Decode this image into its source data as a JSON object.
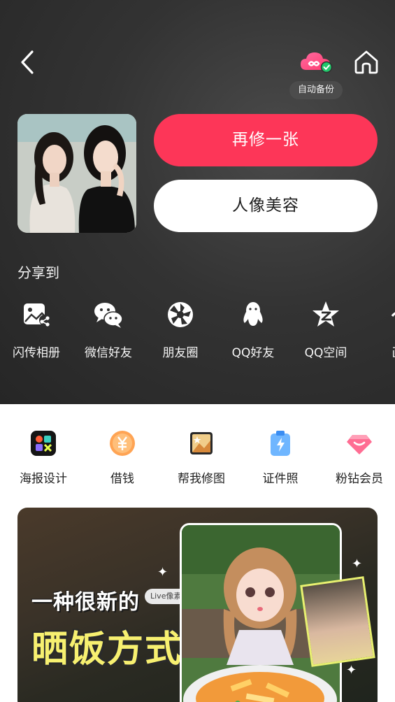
{
  "header": {
    "back_icon": "chevron-left-icon",
    "cloud_icon": "cloud-infinity-icon",
    "home_icon": "home-icon",
    "backup_label": "自动备份"
  },
  "actions": {
    "retouch_again": "再修一张",
    "portrait_beauty": "人像美容"
  },
  "share": {
    "title": "分享到",
    "items": [
      {
        "label": "闪传相册",
        "icon": "flash-album-icon"
      },
      {
        "label": "微信好友",
        "icon": "wechat-icon"
      },
      {
        "label": "朋友圈",
        "icon": "moments-icon"
      },
      {
        "label": "QQ好友",
        "icon": "qq-icon"
      },
      {
        "label": "QQ空间",
        "icon": "qzone-icon"
      },
      {
        "label": "画",
        "icon": "partial-icon"
      }
    ]
  },
  "services": {
    "items": [
      {
        "label": "海报设计",
        "icon": "poster-design-icon"
      },
      {
        "label": "借钱",
        "icon": "loan-icon"
      },
      {
        "label": "帮我修图",
        "icon": "photo-edit-help-icon"
      },
      {
        "label": "证件照",
        "icon": "id-photo-icon"
      },
      {
        "label": "粉钻会员",
        "icon": "pink-diamond-icon"
      }
    ]
  },
  "banner": {
    "line1": "一种很新的",
    "line2": "晒饭方式",
    "badge": "Live像素动画"
  },
  "colors": {
    "primary": "#fd3658",
    "dark_bg": "#2e2e2e",
    "banner_yellow": "#f7f070"
  }
}
